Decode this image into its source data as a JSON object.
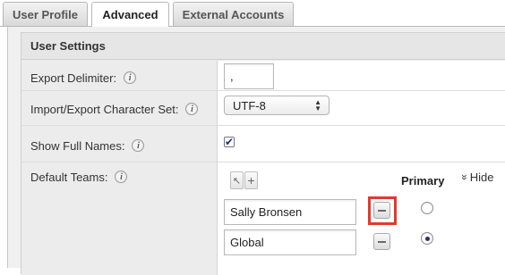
{
  "tabs": [
    {
      "label": "User Profile",
      "active": false
    },
    {
      "label": "Advanced",
      "active": true
    },
    {
      "label": "External Accounts",
      "active": false
    }
  ],
  "section": {
    "title": "User Settings"
  },
  "fields": {
    "export_delimiter": {
      "label": "Export Delimiter:",
      "value": ","
    },
    "charset": {
      "label": "Import/Export Character Set:",
      "value": "UTF-8"
    },
    "show_full_names": {
      "label": "Show Full Names:",
      "checked": true,
      "check_glyph": "✔"
    },
    "default_teams": {
      "label": "Default Teams:",
      "primary_header": "Primary",
      "hide_label": "Hide",
      "hide_glyph": "»",
      "teams": [
        {
          "name": "Sally Bronsen",
          "primary": false
        },
        {
          "name": "Global",
          "primary": true
        }
      ]
    }
  },
  "icons": {
    "info": "i",
    "select_arrows_up": "▲",
    "select_arrows_down": "▼",
    "cursor": "↖",
    "add": "+"
  },
  "colors": {
    "highlight": "#e23a2a",
    "checkmark": "#1b2b88"
  }
}
